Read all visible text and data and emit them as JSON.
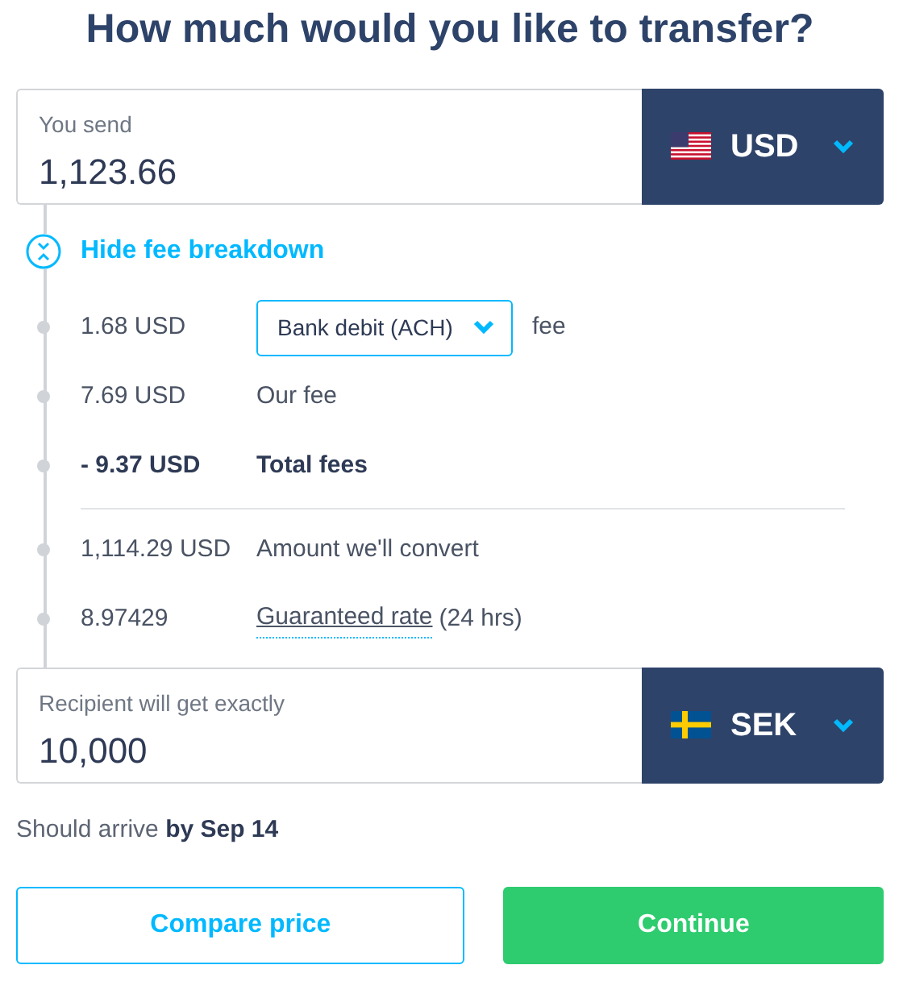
{
  "title": "How much would you like to transfer?",
  "send": {
    "label": "You send",
    "value": "1,123.66",
    "currency": "USD"
  },
  "breakdown_toggle": {
    "label": "Hide fee breakdown",
    "expanded": true
  },
  "fee_rows": [
    {
      "kind": "method",
      "amount": "1.68 USD",
      "method": "Bank debit (ACH)",
      "label": "fee"
    },
    {
      "kind": "plain",
      "amount": "7.69 USD",
      "label": "Our fee"
    },
    {
      "kind": "total",
      "amount": "- 9.37 USD",
      "label": "Total fees"
    }
  ],
  "summary_rows": [
    {
      "kind": "plain",
      "amount": "1,114.29 USD",
      "label": "Amount we'll convert"
    },
    {
      "kind": "rate",
      "amount": "8.97429",
      "link": "Guaranteed rate",
      "label": "(24 hrs)"
    }
  ],
  "receive": {
    "label": "Recipient will get exactly",
    "value": "10,000",
    "currency": "SEK"
  },
  "arrival": "Should arrive **by Sep 14**",
  "buttons": [
    {
      "kind": "secondary",
      "label": "Compare price"
    },
    {
      "kind": "primary",
      "label": "Continue"
    }
  ]
}
